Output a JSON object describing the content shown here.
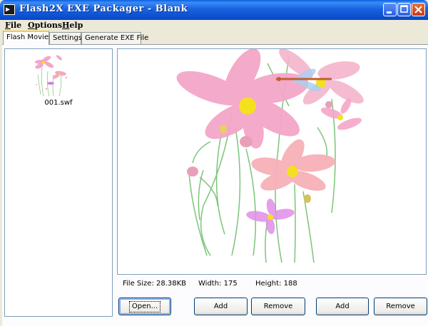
{
  "window": {
    "title": "Flash2X EXE Packager - Blank",
    "icon": "flash-app-icon"
  },
  "menu": [
    {
      "label": "File",
      "accel": "F",
      "rest": "ile"
    },
    {
      "label": "Options",
      "accel": "O",
      "rest": "ptions"
    },
    {
      "label": "Help",
      "accel": "H",
      "rest": "elp"
    }
  ],
  "tabs": [
    {
      "label": "Flash Movies",
      "active": true
    },
    {
      "label": "Settings",
      "active": false
    },
    {
      "label": "Generate EXE File",
      "active": false
    }
  ],
  "movie_list": [
    {
      "filename": "001.swf",
      "thumbnail": "flower-thumbnail"
    }
  ],
  "preview": {
    "image": "pink-cosmos-flowers-with-dragonfly"
  },
  "info": {
    "file_size_label": "File Size:",
    "file_size": "28.38KB",
    "width_label": "Width:",
    "width": "175",
    "height_label": "Height:",
    "height": "188"
  },
  "buttons": {
    "open": "Open...",
    "add1": "Add",
    "remove1": "Remove",
    "add2": "Add",
    "remove2": "Remove"
  },
  "colors": {
    "titlebar": "#0a4fd0",
    "tab_highlight": "#ffc83c",
    "flower_pink": "#f29cc4",
    "flower_center": "#f5e020"
  }
}
